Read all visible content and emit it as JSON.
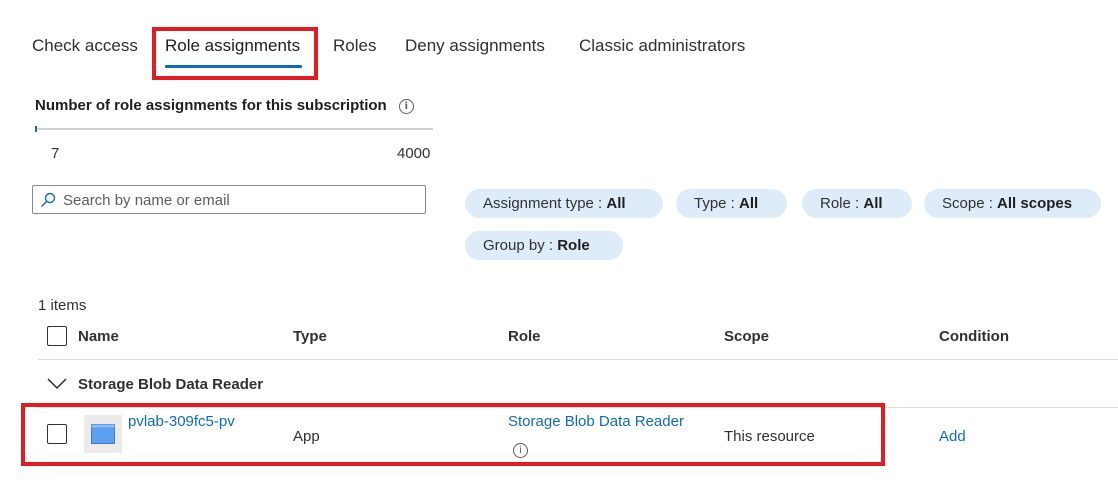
{
  "tabs": [
    {
      "label": "Check access"
    },
    {
      "label": "Role assignments"
    },
    {
      "label": "Roles"
    },
    {
      "label": "Deny assignments"
    },
    {
      "label": "Classic administrators"
    }
  ],
  "active_tab": "Role assignments",
  "counter": {
    "title": "Number of role assignments for this subscription",
    "current": "7",
    "max": "4000",
    "fill_fraction": 0.00175
  },
  "search": {
    "placeholder": "Search by name or email"
  },
  "filters": [
    {
      "label": "Assignment type : ",
      "value": "All"
    },
    {
      "label": "Type : ",
      "value": "All"
    },
    {
      "label": "Role : ",
      "value": "All"
    },
    {
      "label": "Scope : ",
      "value": "All scopes"
    },
    {
      "label": "Group by : ",
      "value": "Role"
    }
  ],
  "table": {
    "item_count": "1 items",
    "columns": [
      "Name",
      "Type",
      "Role",
      "Scope",
      "Condition"
    ],
    "group": {
      "label": "Storage Blob Data Reader"
    },
    "rows": [
      {
        "name": "pvlab-309fc5-pv",
        "type": "App",
        "role": "Storage Blob Data Reader",
        "scope": "This resource",
        "condition": "Add"
      }
    ]
  },
  "colors": {
    "accent": "#0f6cbd",
    "highlight": "#e31b23",
    "pill_bg": "#deecf9"
  }
}
